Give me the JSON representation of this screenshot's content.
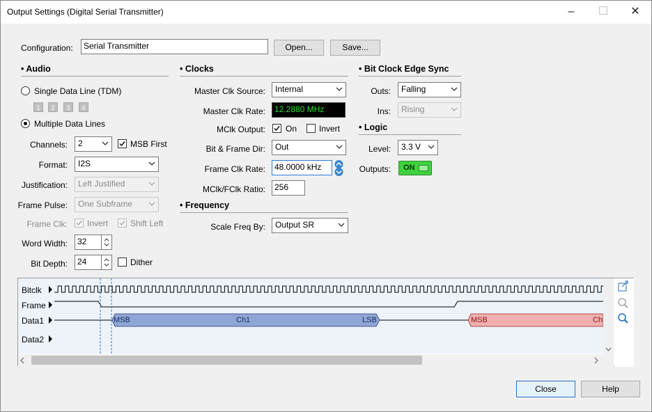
{
  "window": {
    "title": "Output Settings (Digital Serial Transmitter)"
  },
  "config": {
    "label": "Configuration:",
    "value": "Serial Transmitter",
    "open": "Open...",
    "save": "Save..."
  },
  "audio": {
    "heading": "Audio",
    "single_line": "Single Data Line (TDM)",
    "tdm_slots": [
      "1",
      "2",
      "3",
      "4"
    ],
    "multiple_lines": "Multiple Data Lines",
    "channels_label": "Channels:",
    "channels": "2",
    "msb_first": "MSB First",
    "format_label": "Format:",
    "format": "I2S",
    "justification_label": "Justification:",
    "justification": "Left Justified",
    "frame_pulse_label": "Frame Pulse:",
    "frame_pulse": "One Subframe",
    "frame_clk_label": "Frame Clk:",
    "invert": "Invert",
    "shift_left": "Shift Left",
    "word_width_label": "Word Width:",
    "word_width": "32",
    "bit_depth_label": "Bit Depth:",
    "bit_depth": "24",
    "dither": "Dither"
  },
  "clocks": {
    "heading": "Clocks",
    "master_src_label": "Master Clk Source:",
    "master_src": "Internal",
    "master_rate_label": "Master Clk Rate:",
    "master_rate": "12.2880 MHz",
    "mclk_output_label": "MClk Output:",
    "on": "On",
    "invert": "Invert",
    "bit_frame_dir_label": "Bit & Frame Dir:",
    "bit_frame_dir": "Out",
    "frame_rate_label": "Frame Clk Rate:",
    "frame_rate": "48.0000 kHz",
    "ratio_label": "MClk/FClk Ratio:",
    "ratio": "256"
  },
  "frequency": {
    "heading": "Frequency",
    "scale_label": "Scale Freq By:",
    "scale": "Output SR"
  },
  "edge": {
    "heading": "Bit Clock Edge Sync",
    "outs_label": "Outs:",
    "outs": "Falling",
    "ins_label": "Ins:",
    "ins": "Rising"
  },
  "logic": {
    "heading": "Logic",
    "level_label": "Level:",
    "level": "3.3 V",
    "outputs_label": "Outputs:",
    "outputs": "ON"
  },
  "waveform": {
    "rows": [
      "Bitclk",
      "Frame",
      "Data1",
      "Data2"
    ],
    "msb": "MSB",
    "ch1": "Ch1",
    "lsb": "LSB",
    "msb2": "MSB",
    "ch2_partial": "Ch"
  },
  "footer": {
    "close": "Close",
    "help": "Help"
  },
  "colors": {
    "lcd_bg": "#000000",
    "lcd_fg": "#27e027",
    "on_green": "#3fd13f",
    "ch1_fill": "#8fa6d6",
    "ch2_fill": "#f0b0b0"
  }
}
